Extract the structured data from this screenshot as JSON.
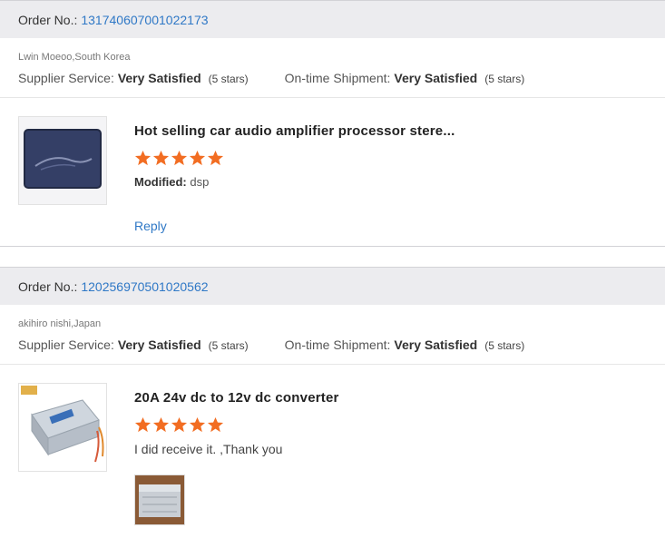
{
  "orders": [
    {
      "order_label": "Order No.:",
      "order_number": "131740607001022173",
      "buyer": "Lwin Moeoo,South Korea",
      "supplier_label": "Supplier Service:",
      "supplier_value": "Very Satisfied",
      "supplier_stars": "(5 stars)",
      "shipment_label": "On-time Shipment:",
      "shipment_value": "Very Satisfied",
      "shipment_stars": "(5 stars)",
      "product_title": "Hot selling car audio amplifier processor stere...",
      "rating": 5,
      "detail_label": "Modified:",
      "detail_value": "dsp",
      "reply_label": "Reply"
    },
    {
      "order_label": "Order No.:",
      "order_number": "120256970501020562",
      "buyer": "akihiro nishi,Japan",
      "supplier_label": "Supplier Service:",
      "supplier_value": "Very Satisfied",
      "supplier_stars": "(5 stars)",
      "shipment_label": "On-time Shipment:",
      "shipment_value": "Very Satisfied",
      "shipment_stars": "(5 stars)",
      "product_title": "20A 24v dc to 12v dc converter",
      "rating": 5,
      "review_text": "I did receive it.  ,Thank you"
    }
  ],
  "colors": {
    "link": "#2f78c6",
    "star": "#f26d22",
    "header_bg": "#ececef"
  }
}
